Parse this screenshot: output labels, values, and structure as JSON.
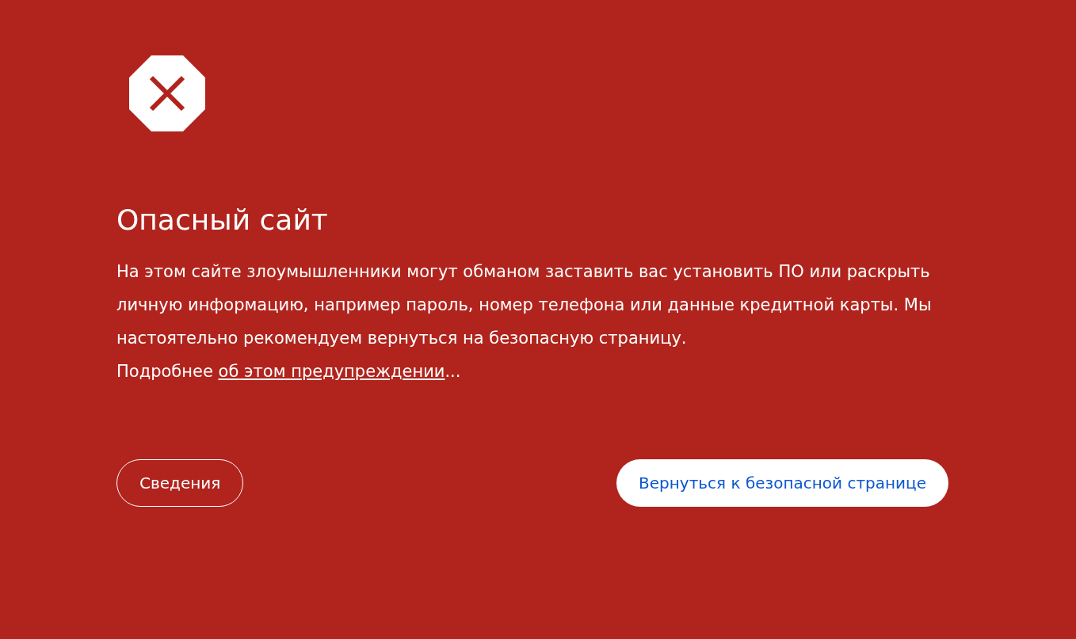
{
  "title": "Опасный сайт",
  "description": "На этом сайте злоумышленники могут обманом заставить вас установить ПО или раскрыть личную информацию, например пароль, номер телефона или данные кредитной карты. Мы настоятельно рекомендуем вернуться на безопасную страницу.",
  "learn_more": {
    "prefix": "Подробнее",
    "link": "об этом предупреждении",
    "suffix": "..."
  },
  "buttons": [
    {
      "label": "Сведения",
      "kind": "outline"
    },
    {
      "label": "Вернуться к безопасной странице",
      "kind": "primary"
    }
  ]
}
